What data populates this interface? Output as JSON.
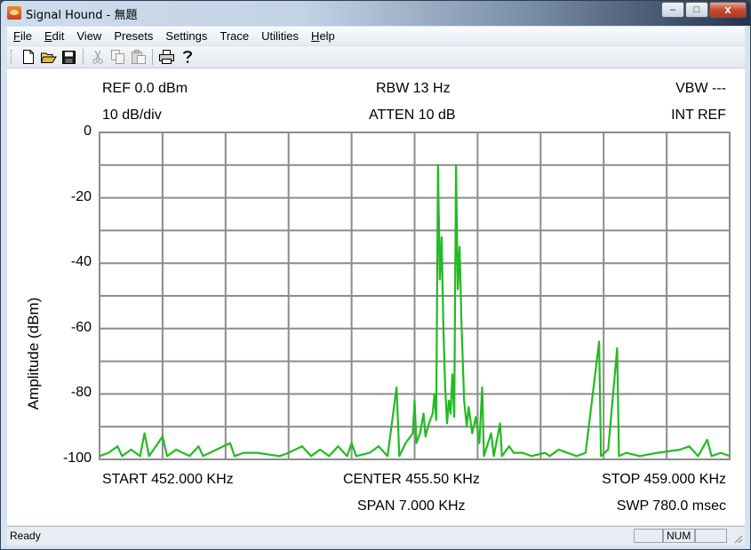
{
  "window": {
    "title": "Signal Hound - 無題",
    "controls": {
      "minimize": "–",
      "maximize": "□",
      "close": "x"
    }
  },
  "menubar": {
    "items": [
      {
        "label": "File",
        "underline": true
      },
      {
        "label": "Edit",
        "underline": true
      },
      {
        "label": "View",
        "underline": false
      },
      {
        "label": "Presets",
        "underline": false
      },
      {
        "label": "Settings",
        "underline": false
      },
      {
        "label": "Trace",
        "underline": false
      },
      {
        "label": "Utilities",
        "underline": false
      },
      {
        "label": "Help",
        "underline": true
      }
    ]
  },
  "toolbar": {
    "buttons": [
      "new-file-icon",
      "open-folder-icon",
      "save-icon",
      "cut-icon",
      "copy-icon",
      "paste-icon",
      "print-icon",
      "help-icon"
    ]
  },
  "readouts": {
    "ref": "REF 0.0 dBm",
    "scale": "10 dB/div",
    "rbw": "RBW 13 Hz",
    "atten": "ATTEN 10 dB",
    "vbw": "VBW ---",
    "ref_source": "INT REF",
    "start": "START 452.000 KHz",
    "center": "CENTER 455.50 KHz",
    "span": "SPAN 7.000 KHz",
    "stop": "STOP 459.000 KHz",
    "sweep": "SWP 780.0 msec"
  },
  "status": {
    "text": "Ready",
    "num": "NUM"
  },
  "colors": {
    "trace": "#22bb22",
    "grid": "#8c8c8c"
  },
  "chart_data": {
    "type": "line",
    "ylabel": "Amplitude (dBm)",
    "ylim": [
      -100,
      0
    ],
    "xlim": [
      452.0,
      459.0
    ],
    "x_unit": "KHz",
    "y_ticks": [
      "0",
      "-20",
      "-40",
      "-60",
      "-80",
      "-100"
    ],
    "x_divisions": 10,
    "y_divisions": 10,
    "series": [
      {
        "points": [
          [
            452.0,
            -99
          ],
          [
            452.1,
            -98
          ],
          [
            452.2,
            -96
          ],
          [
            452.25,
            -99
          ],
          [
            452.35,
            -97
          ],
          [
            452.45,
            -99
          ],
          [
            452.5,
            -92
          ],
          [
            452.55,
            -99
          ],
          [
            452.7,
            -93
          ],
          [
            452.75,
            -99
          ],
          [
            452.85,
            -97
          ],
          [
            453.0,
            -99
          ],
          [
            453.1,
            -96
          ],
          [
            453.15,
            -99
          ],
          [
            453.45,
            -95
          ],
          [
            453.5,
            -99
          ],
          [
            453.6,
            -98
          ],
          [
            453.75,
            -98
          ],
          [
            454.0,
            -99
          ],
          [
            454.1,
            -98
          ],
          [
            454.25,
            -96
          ],
          [
            454.35,
            -99
          ],
          [
            454.45,
            -97
          ],
          [
            454.55,
            -99
          ],
          [
            454.65,
            -96
          ],
          [
            454.75,
            -99
          ],
          [
            454.8,
            -95
          ],
          [
            454.85,
            -99
          ],
          [
            455.0,
            -98
          ],
          [
            455.1,
            -96
          ],
          [
            455.2,
            -99
          ],
          [
            455.3,
            -78
          ],
          [
            455.33,
            -99
          ],
          [
            455.4,
            -95
          ],
          [
            455.48,
            -92
          ],
          [
            455.5,
            -82
          ],
          [
            455.52,
            -95
          ],
          [
            455.56,
            -92
          ],
          [
            455.6,
            -86
          ],
          [
            455.62,
            -93
          ],
          [
            455.66,
            -89
          ],
          [
            455.7,
            -86
          ],
          [
            455.72,
            -80
          ],
          [
            455.74,
            -88
          ],
          [
            455.76,
            -10
          ],
          [
            455.78,
            -45
          ],
          [
            455.8,
            -32
          ],
          [
            455.82,
            -60
          ],
          [
            455.84,
            -78
          ],
          [
            455.86,
            -89
          ],
          [
            455.88,
            -82
          ],
          [
            455.9,
            -86
          ],
          [
            455.92,
            -74
          ],
          [
            455.94,
            -87
          ],
          [
            455.96,
            -10
          ],
          [
            455.98,
            -48
          ],
          [
            456.0,
            -35
          ],
          [
            456.02,
            -58
          ],
          [
            456.05,
            -82
          ],
          [
            456.08,
            -90
          ],
          [
            456.1,
            -84
          ],
          [
            456.14,
            -92
          ],
          [
            456.18,
            -87
          ],
          [
            456.22,
            -95
          ],
          [
            456.25,
            -78
          ],
          [
            456.27,
            -99
          ],
          [
            456.35,
            -92
          ],
          [
            456.38,
            -99
          ],
          [
            456.45,
            -89
          ],
          [
            456.47,
            -99
          ],
          [
            456.55,
            -96
          ],
          [
            456.6,
            -98
          ],
          [
            456.7,
            -98
          ],
          [
            456.8,
            -99
          ],
          [
            456.95,
            -98
          ],
          [
            457.0,
            -99
          ],
          [
            457.1,
            -97
          ],
          [
            457.3,
            -99
          ],
          [
            457.4,
            -98
          ],
          [
            457.55,
            -64
          ],
          [
            457.57,
            -99
          ],
          [
            457.65,
            -97
          ],
          [
            457.75,
            -66
          ],
          [
            457.77,
            -99
          ],
          [
            457.85,
            -98
          ],
          [
            458.0,
            -99
          ],
          [
            458.2,
            -98
          ],
          [
            458.45,
            -97
          ],
          [
            458.55,
            -96
          ],
          [
            458.65,
            -99
          ],
          [
            458.75,
            -94
          ],
          [
            458.8,
            -99
          ],
          [
            458.9,
            -98
          ],
          [
            459.0,
            -99
          ]
        ]
      }
    ]
  }
}
